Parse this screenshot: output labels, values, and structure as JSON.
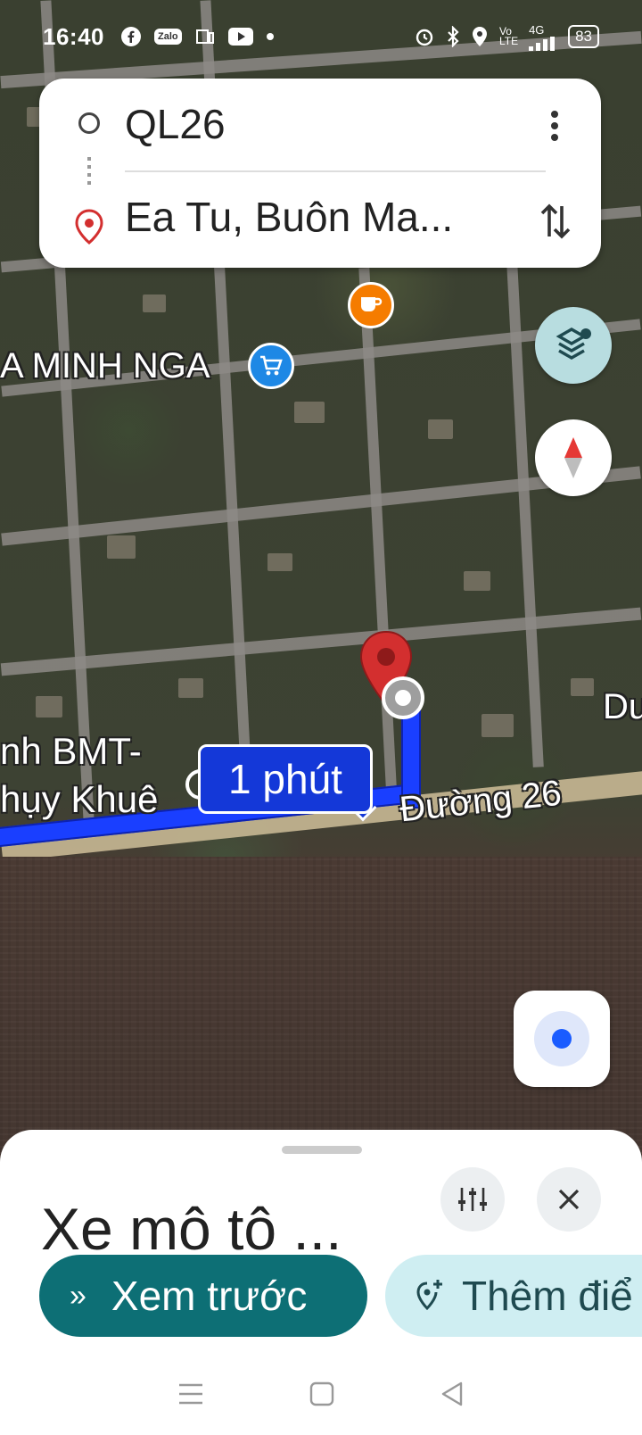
{
  "status_bar": {
    "time": "16:40",
    "left_icons": [
      "facebook-icon",
      "zalo-icon",
      "news-icon",
      "youtube-icon",
      "dot-icon"
    ],
    "zalo_label": "Zalo",
    "right_icons": [
      "alarm-icon",
      "bluetooth-icon",
      "location-icon",
      "volte-icon",
      "signal-icon"
    ],
    "network": "4G",
    "battery": "83"
  },
  "route": {
    "origin": "QL26",
    "destination": "Ea Tu, Buôn Ma...",
    "more_icon": "more-vert-icon",
    "swap_icon": "swap-vert-icon"
  },
  "map": {
    "labels": {
      "store": "A MINH NGA",
      "place_line1": "nh BMT-",
      "place_line2": "hụy Khuê",
      "road_name": "Đường 26",
      "edge_label": "Du"
    },
    "duration": "1 phút",
    "poi_colors": {
      "cafe": "#f57c00",
      "shop": "#1e88e5"
    },
    "route_color": "#1a3fff",
    "pin_color": "#d32f2f"
  },
  "sheet": {
    "mode_title": "Xe mô tô ...",
    "preview_label": "Xem trước",
    "add_stop_label": "Thêm điể",
    "filter_icon": "tune-icon",
    "close_icon": "close-icon"
  },
  "nav": {
    "menu_icon": "menu-icon",
    "home_icon": "home-square-icon",
    "back_icon": "back-triangle-icon"
  },
  "colors": {
    "accent": "#0d6f75",
    "secondary_button": "#cfeef2",
    "route_badge": "#1438d8"
  }
}
